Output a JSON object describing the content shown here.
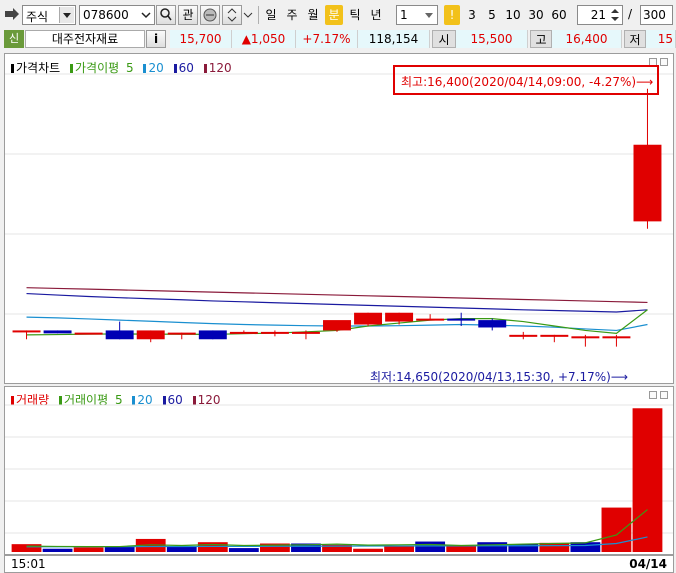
{
  "toolbar": {
    "market_select": "주식",
    "code_input": "078600",
    "search_btn": "⌕",
    "interest_btn": "관",
    "periods": [
      "일",
      "주",
      "월",
      "분",
      "틱",
      "년"
    ],
    "selected_period": "분",
    "interval_value": "1",
    "minute_steps": [
      "1",
      "3",
      "5",
      "10",
      "30",
      "60"
    ],
    "selected_step": "1",
    "count_value": "21",
    "count_separator": "/",
    "count_total": "300"
  },
  "info_bar": {
    "credit_badge": "신",
    "stock_name": "대주전자재료",
    "info_btn": "i",
    "price": "15,700",
    "change": "▲1,050",
    "change_rate": "+7.17%",
    "volume": "118,154",
    "open_label": "시",
    "open_value": "15,500",
    "high_label": "고",
    "high_value": "16,400",
    "low_label": "저",
    "low_value": "15"
  },
  "price_chart": {
    "legend_title": "가격차트",
    "legend_ma_label": "가격이평",
    "legend_ma": [
      "5",
      "20",
      "60",
      "120"
    ],
    "high_annotation": "최고:16,400(2020/04/14,09:00, -4.27%)⟶",
    "low_annotation": "최저:14,650(2020/04/13,15:30, +7.17%)⟶"
  },
  "volume_chart": {
    "legend_title": "거래량",
    "legend_ma_label": "거래이평",
    "legend_ma": [
      "5",
      "20",
      "60",
      "120"
    ]
  },
  "time_axis": {
    "left_label": "15:01",
    "right_label": "04/14"
  },
  "colors": {
    "up": "#e00000",
    "down": "#0000b4",
    "ma5": "#3a9a14",
    "ma20": "#1a8fd0",
    "ma60": "#1a1aa0",
    "ma120": "#8a1a3a",
    "highlight_box": "#e00000"
  },
  "chart_data": {
    "type": "candlestick",
    "candle_count": 21,
    "candles": [
      {
        "o": 14750,
        "h": 14760,
        "l": 14700,
        "c": 14760
      },
      {
        "o": 14760,
        "h": 14760,
        "l": 14740,
        "c": 14740
      },
      {
        "o": 14745,
        "h": 14745,
        "l": 14745,
        "c": 14745
      },
      {
        "o": 14760,
        "h": 14820,
        "l": 14700,
        "c": 14700
      },
      {
        "o": 14700,
        "h": 14760,
        "l": 14680,
        "c": 14760
      },
      {
        "o": 14745,
        "h": 14745,
        "l": 14700,
        "c": 14745
      },
      {
        "o": 14760,
        "h": 14760,
        "l": 14700,
        "c": 14700
      },
      {
        "o": 14745,
        "h": 14760,
        "l": 14740,
        "c": 14750
      },
      {
        "o": 14750,
        "h": 14760,
        "l": 14720,
        "c": 14750
      },
      {
        "o": 14740,
        "h": 14760,
        "l": 14700,
        "c": 14750
      },
      {
        "o": 14760,
        "h": 14780,
        "l": 14750,
        "c": 14830
      },
      {
        "o": 14800,
        "h": 14880,
        "l": 14790,
        "c": 14880
      },
      {
        "o": 14820,
        "h": 14880,
        "l": 14800,
        "c": 14880
      },
      {
        "o": 14830,
        "h": 14870,
        "l": 14830,
        "c": 14840
      },
      {
        "o": 14840,
        "h": 14880,
        "l": 14790,
        "c": 14830
      },
      {
        "o": 14830,
        "h": 14840,
        "l": 14760,
        "c": 14780
      },
      {
        "o": 14730,
        "h": 14750,
        "l": 14700,
        "c": 14730
      },
      {
        "o": 14730,
        "h": 14730,
        "l": 14680,
        "c": 14730
      },
      {
        "o": 14720,
        "h": 14730,
        "l": 14650,
        "c": 14720
      },
      {
        "o": 14720,
        "h": 14730,
        "l": 14650,
        "c": 14720
      },
      {
        "o": 15500,
        "h": 16400,
        "l": 15450,
        "c": 16020
      }
    ],
    "price_range": [
      14600,
      16500
    ],
    "ma5": [
      14730,
      14732,
      14735,
      14736,
      14735,
      14734,
      14733,
      14738,
      14742,
      14750,
      14760,
      14790,
      14810,
      14830,
      14840,
      14840,
      14820,
      14790,
      14760,
      14740,
      14900
    ],
    "ma20": [
      14850,
      14845,
      14838,
      14830,
      14822,
      14814,
      14806,
      14800,
      14796,
      14792,
      14790,
      14790,
      14792,
      14796,
      14800,
      14796,
      14790,
      14782,
      14770,
      14760,
      14800
    ],
    "ma60": [
      15010,
      15000,
      14990,
      14982,
      14975,
      14968,
      14960,
      14954,
      14948,
      14942,
      14936,
      14930,
      14924,
      14918,
      14912,
      14906,
      14900,
      14895,
      14890,
      14885,
      14900
    ],
    "ma120": [
      15050,
      15045,
      15040,
      15035,
      15030,
      15025,
      15020,
      15015,
      15010,
      15005,
      15000,
      14995,
      14990,
      14985,
      14980,
      14975,
      14970,
      14965,
      14960,
      14955,
      14950
    ],
    "volume": [
      1200,
      500,
      700,
      800,
      2000,
      900,
      1500,
      600,
      1300,
      1300,
      1100,
      500,
      900,
      1600,
      1000,
      1500,
      1200,
      1400,
      1500,
      6800,
      22000
    ],
    "volume_up": [
      true,
      false,
      true,
      false,
      true,
      false,
      true,
      false,
      true,
      false,
      true,
      true,
      true,
      false,
      true,
      false,
      false,
      true,
      false,
      true,
      true
    ],
    "volume_range": [
      0,
      22500
    ],
    "vma5": [
      900,
      850,
      820,
      830,
      1100,
      1000,
      1150,
      1000,
      1050,
      1100,
      1200,
      1050,
      1100,
      1150,
      1000,
      1100,
      1200,
      1300,
      1400,
      2600,
      6500
    ],
    "vma20": [
      800,
      800,
      810,
      820,
      830,
      840,
      850,
      860,
      870,
      880,
      900,
      910,
      920,
      930,
      940,
      950,
      960,
      980,
      1000,
      1300,
      2300
    ]
  }
}
